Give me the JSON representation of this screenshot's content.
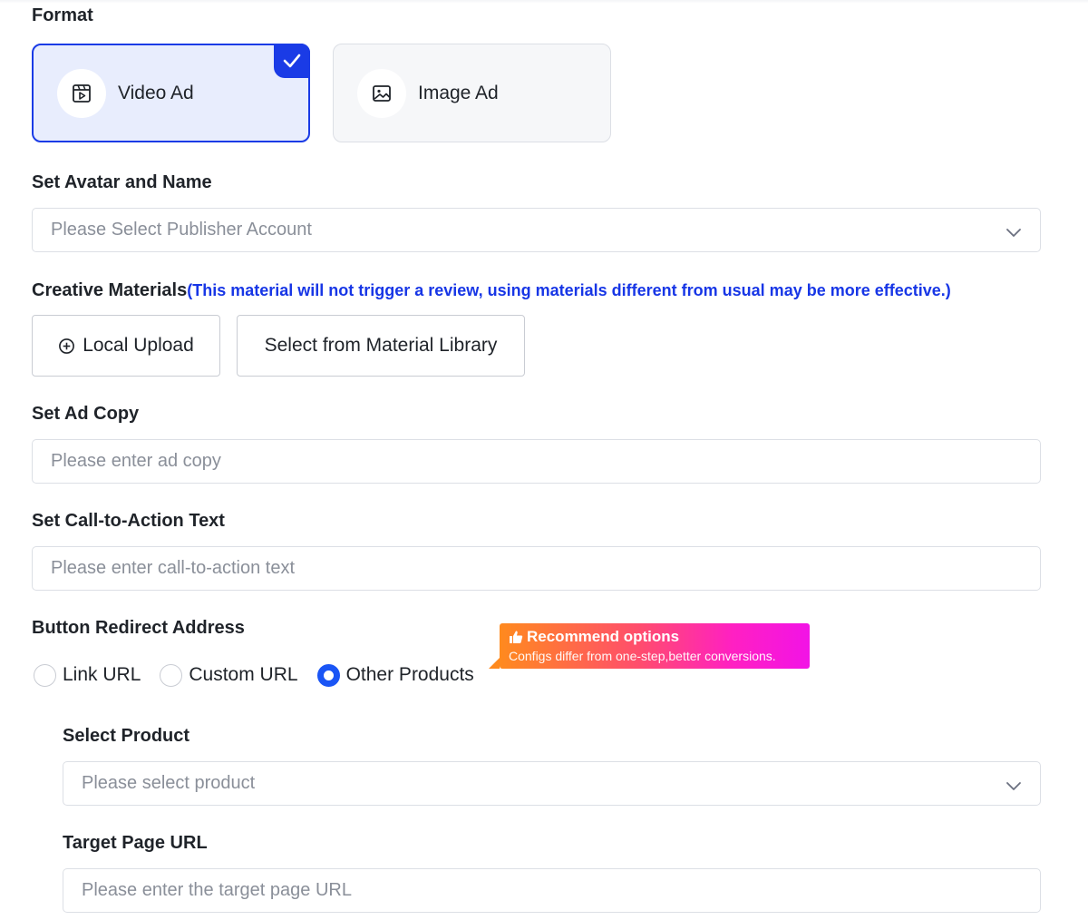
{
  "format": {
    "label": "Format",
    "options": [
      {
        "label": "Video Ad",
        "icon": "video-icon",
        "selected": true
      },
      {
        "label": "Image Ad",
        "icon": "image-icon",
        "selected": false
      }
    ]
  },
  "avatar": {
    "label": "Set Avatar and Name",
    "placeholder": "Please Select Publisher Account"
  },
  "creative": {
    "label": "Creative Materials",
    "note": "(This material will not trigger a review, using materials different from usual may be more effective.)",
    "local_upload": "Local Upload",
    "library": "Select from Material Library"
  },
  "ad_copy": {
    "label": "Set Ad Copy",
    "placeholder": "Please enter ad copy"
  },
  "cta": {
    "label": "Set Call-to-Action Text",
    "placeholder": "Please enter call-to-action text"
  },
  "redirect": {
    "label": "Button Redirect Address",
    "options": [
      "Link URL",
      "Custom URL",
      "Other Products"
    ],
    "selected": "Other Products",
    "badge": {
      "title": "Recommend options",
      "subtitle": "Configs differ from one-step,better conversions."
    }
  },
  "product": {
    "label": "Select Product",
    "placeholder": "Please select product"
  },
  "target": {
    "label": "Target Page URL",
    "placeholder": "Please enter the target page URL"
  },
  "colors": {
    "accent": "#1a3be6",
    "note": "#1736e6",
    "badge_start": "#ff8a1e",
    "badge_end": "#f213e6"
  }
}
